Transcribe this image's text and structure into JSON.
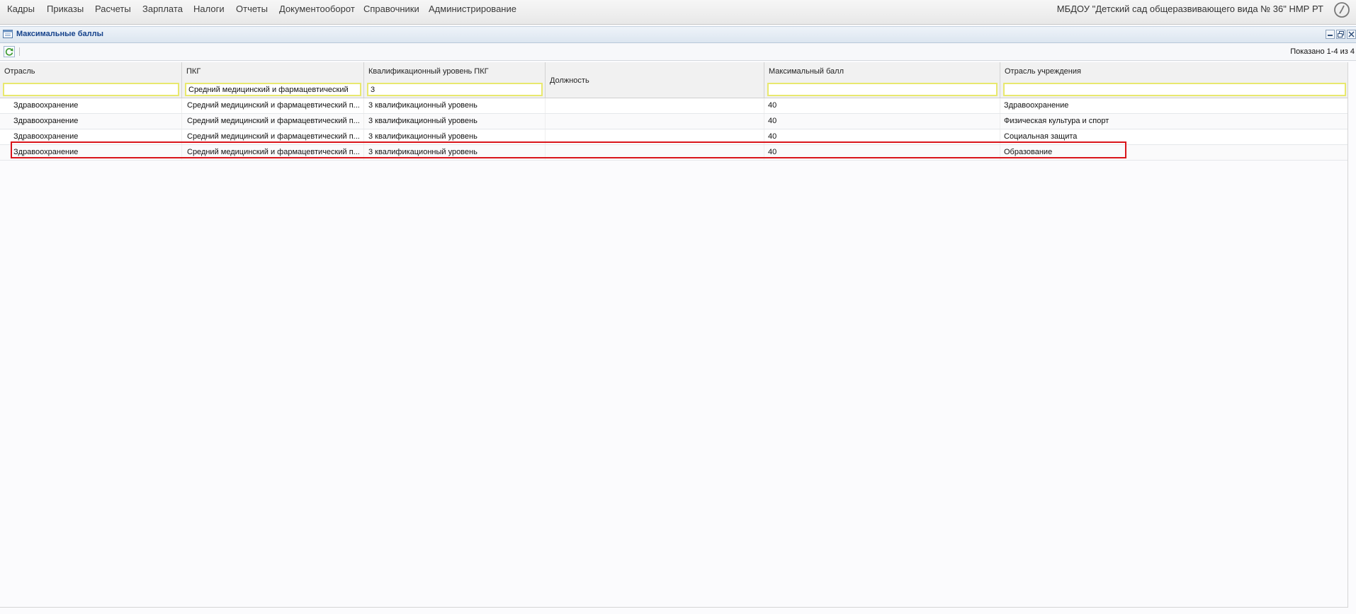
{
  "menu": {
    "items": [
      "Кадры",
      "Приказы",
      "Расчеты",
      "Зарплата",
      "Налоги",
      "Отчеты",
      "Документооборот",
      "Справочники",
      "Администрирование"
    ],
    "organization": "МБДОУ \"Детский сад общеразвивающего вида № 36\" НМР РТ",
    "clock_icon": "clock-icon"
  },
  "window": {
    "title": "Максимальные баллы",
    "icon": "window-icon",
    "buttons": [
      "minimize-icon",
      "restore-icon",
      "close-icon"
    ]
  },
  "toolbar": {
    "refresh_icon": "refresh-icon",
    "paging": "Показано 1-4 из 4"
  },
  "grid": {
    "columns": [
      {
        "key": "otrasl",
        "label": "Отрасль",
        "filter": ""
      },
      {
        "key": "pkg",
        "label": "ПКГ",
        "filter": "Средний медицинский и фармацевтический"
      },
      {
        "key": "level",
        "label": "Квалификационный уровень ПКГ",
        "filter": "3"
      },
      {
        "key": "position",
        "label": "Должность"
      },
      {
        "key": "max",
        "label": "Максимальный балл",
        "filter": ""
      },
      {
        "key": "inst",
        "label": "Отрасль учреждения",
        "filter": ""
      }
    ],
    "rows": [
      [
        "Здравоохранение",
        "Средний медицинский и фармацевтический п...",
        "3 квалификационный уровень",
        "",
        "40",
        "Здравоохранение"
      ],
      [
        "Здравоохранение",
        "Средний медицинский и фармацевтический п...",
        "3 квалификационный уровень",
        "",
        "40",
        "Физическая культура и спорт"
      ],
      [
        "Здравоохранение",
        "Средний медицинский и фармацевтический п...",
        "3 квалификационный уровень",
        "",
        "40",
        "Социальная защита"
      ],
      [
        "Здравоохранение",
        "Средний медицинский и фармацевтический п...",
        "3 квалификационный уровень",
        "",
        "40",
        "Образование"
      ]
    ],
    "highlighted_row": 3
  },
  "colors": {
    "highlight": "#d9141a",
    "filter_border": "#e8e86e",
    "title_text": "#15428b"
  }
}
